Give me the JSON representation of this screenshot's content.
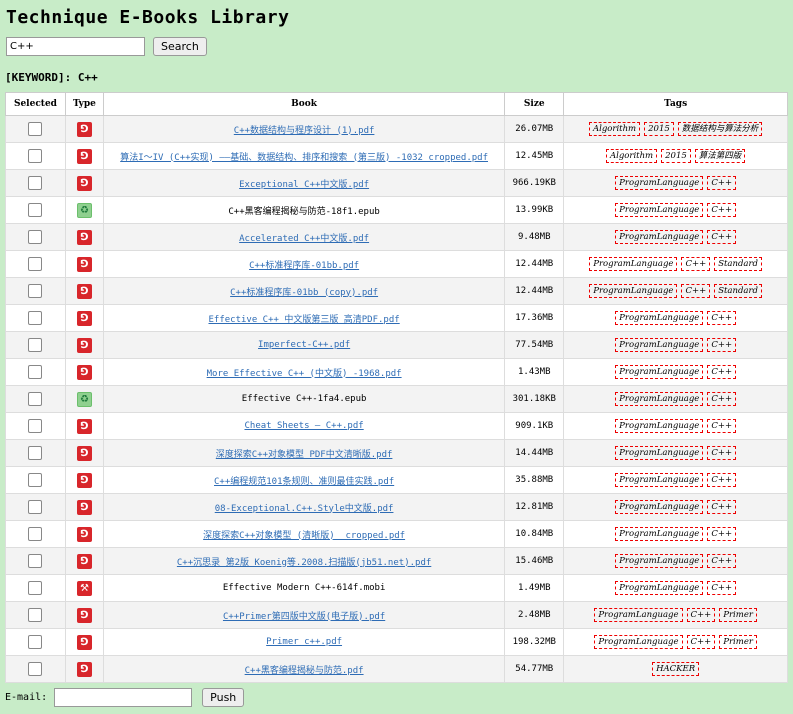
{
  "page": {
    "title": "Technique E-Books Library"
  },
  "search": {
    "value": "C++",
    "button_label": "Search"
  },
  "keyword": {
    "label": "[KEYWORD]:",
    "value": "C++"
  },
  "table": {
    "headers": {
      "selected": "Selected",
      "type": "Type",
      "book": "Book",
      "size": "Size",
      "tags": "Tags"
    },
    "rows": [
      {
        "type": "pdf",
        "type_icon": "pdf-icon",
        "book": "C++数据结构与程序设计 (1).pdf",
        "is_link": true,
        "size": "26.07MB",
        "tags": [
          "Algorithm",
          "2015",
          "数据结构与算法分析"
        ]
      },
      {
        "type": "pdf",
        "type_icon": "pdf-icon",
        "book": "算法I～IV (C++实现) ——基础、数据结构、排序和搜索 (第三版) -1032_cropped.pdf",
        "is_link": true,
        "size": "12.45MB",
        "tags": [
          "Algorithm",
          "2015",
          "算法第四版"
        ]
      },
      {
        "type": "pdf",
        "type_icon": "pdf-icon",
        "book": "Exceptional C++中文版.pdf",
        "is_link": true,
        "size": "966.19KB",
        "tags": [
          "ProgramLanguage",
          "C++"
        ]
      },
      {
        "type": "epub",
        "type_icon": "epub-icon",
        "book": "C++黑客编程揭秘与防范-18f1.epub",
        "is_link": false,
        "size": "13.99KB",
        "tags": [
          "ProgramLanguage",
          "C++"
        ]
      },
      {
        "type": "pdf",
        "type_icon": "pdf-icon",
        "book": "Accelerated C++中文版.pdf",
        "is_link": true,
        "size": "9.48MB",
        "tags": [
          "ProgramLanguage",
          "C++"
        ]
      },
      {
        "type": "pdf",
        "type_icon": "pdf-icon",
        "book": "C++标准程序库-01bb.pdf",
        "is_link": true,
        "size": "12.44MB",
        "tags": [
          "ProgramLanguage",
          "C++",
          "Standard"
        ]
      },
      {
        "type": "pdf",
        "type_icon": "pdf-icon",
        "book": "C++标准程序库-01bb (copy).pdf",
        "is_link": true,
        "size": "12.44MB",
        "tags": [
          "ProgramLanguage",
          "C++",
          "Standard"
        ]
      },
      {
        "type": "pdf",
        "type_icon": "pdf-icon",
        "book": "Effective C++ 中文版第三版 高清PDF.pdf",
        "is_link": true,
        "size": "17.36MB",
        "tags": [
          "ProgramLanguage",
          "C++"
        ]
      },
      {
        "type": "pdf",
        "type_icon": "pdf-icon",
        "book": "Imperfect-C++.pdf",
        "is_link": true,
        "size": "77.54MB",
        "tags": [
          "ProgramLanguage",
          "C++"
        ]
      },
      {
        "type": "pdf",
        "type_icon": "pdf-icon",
        "book": "More Effective C++ (中文版) -1968.pdf",
        "is_link": true,
        "size": "1.43MB",
        "tags": [
          "ProgramLanguage",
          "C++"
        ]
      },
      {
        "type": "epub",
        "type_icon": "epub-icon",
        "book": "Effective C++-1fa4.epub",
        "is_link": false,
        "size": "301.18KB",
        "tags": [
          "ProgramLanguage",
          "C++"
        ]
      },
      {
        "type": "pdf",
        "type_icon": "pdf-icon",
        "book": "Cheat Sheets — C++.pdf",
        "is_link": true,
        "size": "909.1KB",
        "tags": [
          "ProgramLanguage",
          "C++"
        ]
      },
      {
        "type": "pdf",
        "type_icon": "pdf-icon",
        "book": "深度探索C++对象模型 PDF中文清晰版.pdf",
        "is_link": true,
        "size": "14.44MB",
        "tags": [
          "ProgramLanguage",
          "C++"
        ]
      },
      {
        "type": "pdf",
        "type_icon": "pdf-icon",
        "book": "C++编程规范101条规则、准则最佳实践.pdf",
        "is_link": true,
        "size": "35.88MB",
        "tags": [
          "ProgramLanguage",
          "C++"
        ]
      },
      {
        "type": "pdf",
        "type_icon": "pdf-icon",
        "book": "08-Exceptional.C++.Style中文版.pdf",
        "is_link": true,
        "size": "12.81MB",
        "tags": [
          "ProgramLanguage",
          "C++"
        ]
      },
      {
        "type": "pdf",
        "type_icon": "pdf-icon",
        "book": "深度探索C++对象模型 (清晰版) _cropped.pdf",
        "is_link": true,
        "size": "10.84MB",
        "tags": [
          "ProgramLanguage",
          "C++"
        ]
      },
      {
        "type": "pdf",
        "type_icon": "pdf-icon",
        "book": "C++沉思录 第2版 Koenig等.2008.扫描版(jb51.net).pdf",
        "is_link": true,
        "size": "15.46MB",
        "tags": [
          "ProgramLanguage",
          "C++"
        ]
      },
      {
        "type": "mobi",
        "type_icon": "mobi-icon",
        "book": "Effective Modern C++-614f.mobi",
        "is_link": false,
        "size": "1.49MB",
        "tags": [
          "ProgramLanguage",
          "C++"
        ]
      },
      {
        "type": "pdf",
        "type_icon": "pdf-icon",
        "book": "C++Primer第四版中文版(电子版).pdf",
        "is_link": true,
        "size": "2.48MB",
        "tags": [
          "ProgramLanguage",
          "C++",
          "Primer"
        ]
      },
      {
        "type": "pdf",
        "type_icon": "pdf-icon",
        "book": "Primer c++.pdf",
        "is_link": true,
        "size": "198.32MB",
        "tags": [
          "ProgramLanguage",
          "C++",
          "Primer"
        ]
      },
      {
        "type": "pdf",
        "type_icon": "pdf-icon",
        "book": "C++黑客编程揭秘与防范.pdf",
        "is_link": true,
        "size": "54.77MB",
        "tags": [
          "HACKER"
        ]
      }
    ]
  },
  "email": {
    "label": "E-mail:",
    "value": "",
    "button_label": "Push"
  },
  "colors": {
    "background": "#c8ecc8",
    "link": "#2e6cb5",
    "tag_border": "#ee0000",
    "pdf_icon": "#d8262b",
    "epub_icon": "#8fd08f"
  }
}
